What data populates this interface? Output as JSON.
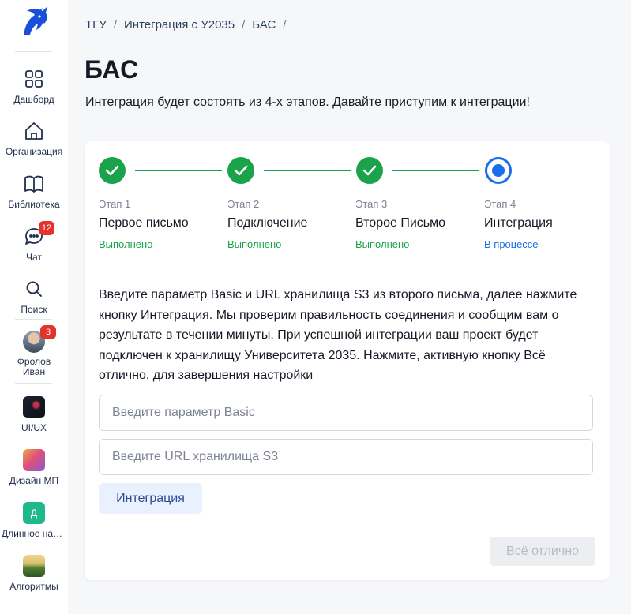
{
  "sidebar": {
    "items": [
      {
        "label": "Дашборд",
        "icon": "grid-icon"
      },
      {
        "label": "Организация",
        "icon": "home-icon"
      },
      {
        "label": "Библиотека",
        "icon": "book-icon"
      },
      {
        "label": "Чат",
        "icon": "chat-icon",
        "badge": "12"
      },
      {
        "label": "Поиск",
        "icon": "search-icon"
      },
      {
        "label": "Фролов Иван",
        "badge": "3"
      },
      {
        "label": "UI/UX"
      },
      {
        "label": "Дизайн МП"
      },
      {
        "label": "Длинное назв...",
        "initial": "Д"
      },
      {
        "label": "Алгоритмы"
      }
    ]
  },
  "breadcrumb": [
    "ТГУ",
    "Интеграция с У2035",
    "БАС"
  ],
  "breadcrumb_sep": "/",
  "page": {
    "title": "БАС",
    "subtitle": "Интеграция будет состоять из 4-х этапов. Давайте приступим к интеграции!"
  },
  "steps": [
    {
      "num": "Этап 1",
      "name": "Первое письмо",
      "status": "Выполнено",
      "state": "done"
    },
    {
      "num": "Этап 2",
      "name": "Подключение",
      "status": "Выполнено",
      "state": "done"
    },
    {
      "num": "Этап 3",
      "name": "Второе Письмо",
      "status": "Выполнено",
      "state": "done"
    },
    {
      "num": "Этап 4",
      "name": "Интеграция",
      "status": "В процессе",
      "state": "active"
    }
  ],
  "instructions": "Введите параметр Basic и URL хранилища S3 из второго письма, далее нажмите кнопку Интеграция. Мы проверим правильность соединения и сообщим вам о результате в течении минуты. При успешной интеграции ваш проект будет подключен к хранилищу Университета 2035. Нажмите, активную кнопку Всё отлично, для завершения настройки",
  "form": {
    "basic_placeholder": "Введите параметр Basic",
    "basic_value": "",
    "url_placeholder": "Введите URL хранилища S3",
    "url_value": "",
    "integrate_label": "Интеграция",
    "done_label": "Всё отлично"
  },
  "colors": {
    "success": "#1aa34a",
    "accent": "#1a6fe8",
    "badge": "#e5322d"
  }
}
